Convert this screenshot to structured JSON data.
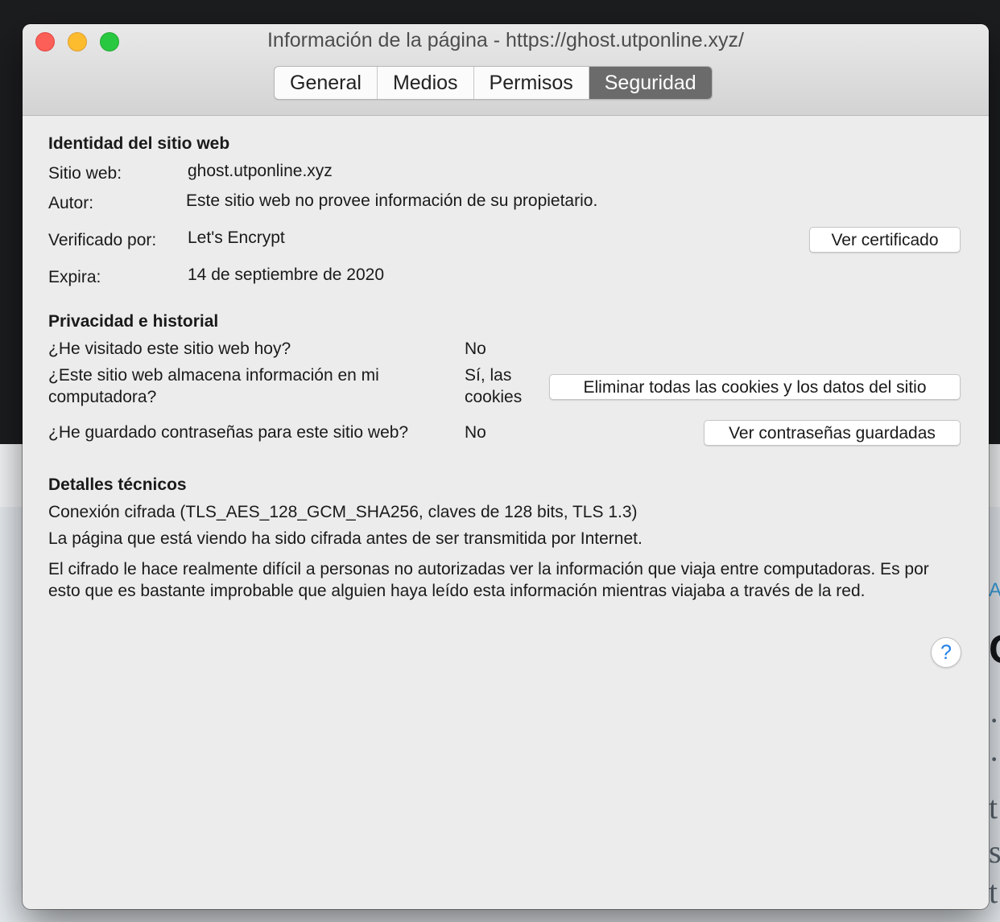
{
  "window": {
    "title": "Información de la página - https://ghost.utponline.xyz/",
    "tabs": [
      {
        "label": "General",
        "active": false
      },
      {
        "label": "Medios",
        "active": false
      },
      {
        "label": "Permisos",
        "active": false
      },
      {
        "label": "Seguridad",
        "active": true
      }
    ]
  },
  "identity": {
    "heading": "Identidad del sitio web",
    "website_label": "Sitio web:",
    "website_value": "ghost.utponline.xyz",
    "author_label": "Autor:",
    "author_value": "Este sitio web no provee información de su propietario.",
    "verified_label": "Verificado por:",
    "verified_value": "Let's Encrypt",
    "view_certificate_button": "Ver certificado",
    "expires_label": "Expira:",
    "expires_value": "14 de septiembre de 2020"
  },
  "privacy": {
    "heading": "Privacidad e historial",
    "visited_question": "¿He visitado este sitio web hoy?",
    "visited_answer": "No",
    "stores_question": "¿Este sitio web almacena información en mi computadora?",
    "stores_answer": "Sí, las cookies",
    "clear_cookies_button": "Eliminar todas las cookies y los datos del sitio",
    "passwords_question": "¿He guardado contraseñas para este sitio web?",
    "passwords_answer": "No",
    "view_passwords_button": "Ver contraseñas guardadas"
  },
  "technical": {
    "heading": "Detalles técnicos",
    "connection": "Conexión cifrada (TLS_AES_128_GCM_SHA256, claves de 128 bits, TLS 1.3)",
    "encrypted_note": "La página que está viendo ha sido cifrada antes de ser transmitida por Internet.",
    "explanation": "El cifrado le hace realmente difícil a personas no autorizadas ver la información que viaja entre computadoras. Es por esto que es bastante improbable que alguien haya leído esta información mientras viajaba a través de la red."
  },
  "help_button": "?",
  "background": {
    "glyphs": [
      "A",
      "C",
      "·,",
      "·'",
      "t",
      "s",
      "t"
    ]
  },
  "colors": {
    "active_tab": "#6b6b6b",
    "close": "#fc5f57",
    "minimize": "#fdbc2e",
    "maximize": "#28c840",
    "help": "#1f7de8"
  }
}
